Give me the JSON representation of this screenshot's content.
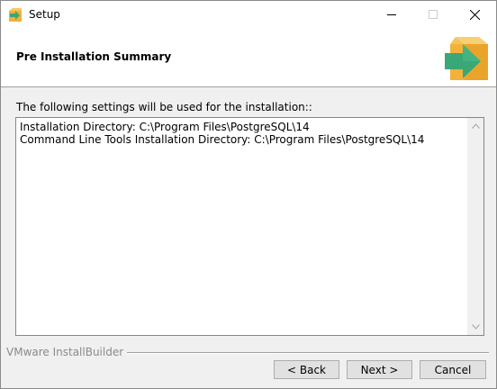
{
  "window": {
    "title": "Setup",
    "controls": [
      "minimize-icon",
      "maximize-icon",
      "close-icon"
    ]
  },
  "header": {
    "title": "Pre Installation Summary",
    "logo_icon": "install-box-arrow-icon"
  },
  "body": {
    "intro": "The following settings will be used for the installation::",
    "summary": "Installation Directory: C:\\Program Files\\PostgreSQL\\14\nCommand Line Tools Installation Directory: C:\\Program Files\\PostgreSQL\\14"
  },
  "footer": {
    "brand": "VMware InstallBuilder",
    "back_label": "< Back",
    "next_label": "Next >",
    "cancel_label": "Cancel"
  },
  "colors": {
    "box_orange": "#f2b13a",
    "arrow_green": "#3aa776"
  }
}
